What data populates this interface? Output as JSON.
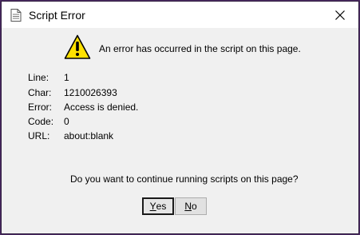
{
  "dialog": {
    "title": "Script Error",
    "message": "An error has occurred in the script on this page.",
    "details": [
      {
        "label": "Line:",
        "value": "1"
      },
      {
        "label": "Char:",
        "value": "1210026393"
      },
      {
        "label": "Error:",
        "value": "Access is denied."
      },
      {
        "label": "Code:",
        "value": "0"
      },
      {
        "label": "URL:",
        "value": "about:blank"
      }
    ],
    "question": "Do you want to continue running scripts on this page?",
    "buttons": {
      "yes": {
        "mnemonic": "Y",
        "rest": "es"
      },
      "no": {
        "mnemonic": "N",
        "rest": "o"
      }
    },
    "icons": {
      "title": "document-icon",
      "warning": "warning-icon",
      "close": "close-icon"
    }
  }
}
